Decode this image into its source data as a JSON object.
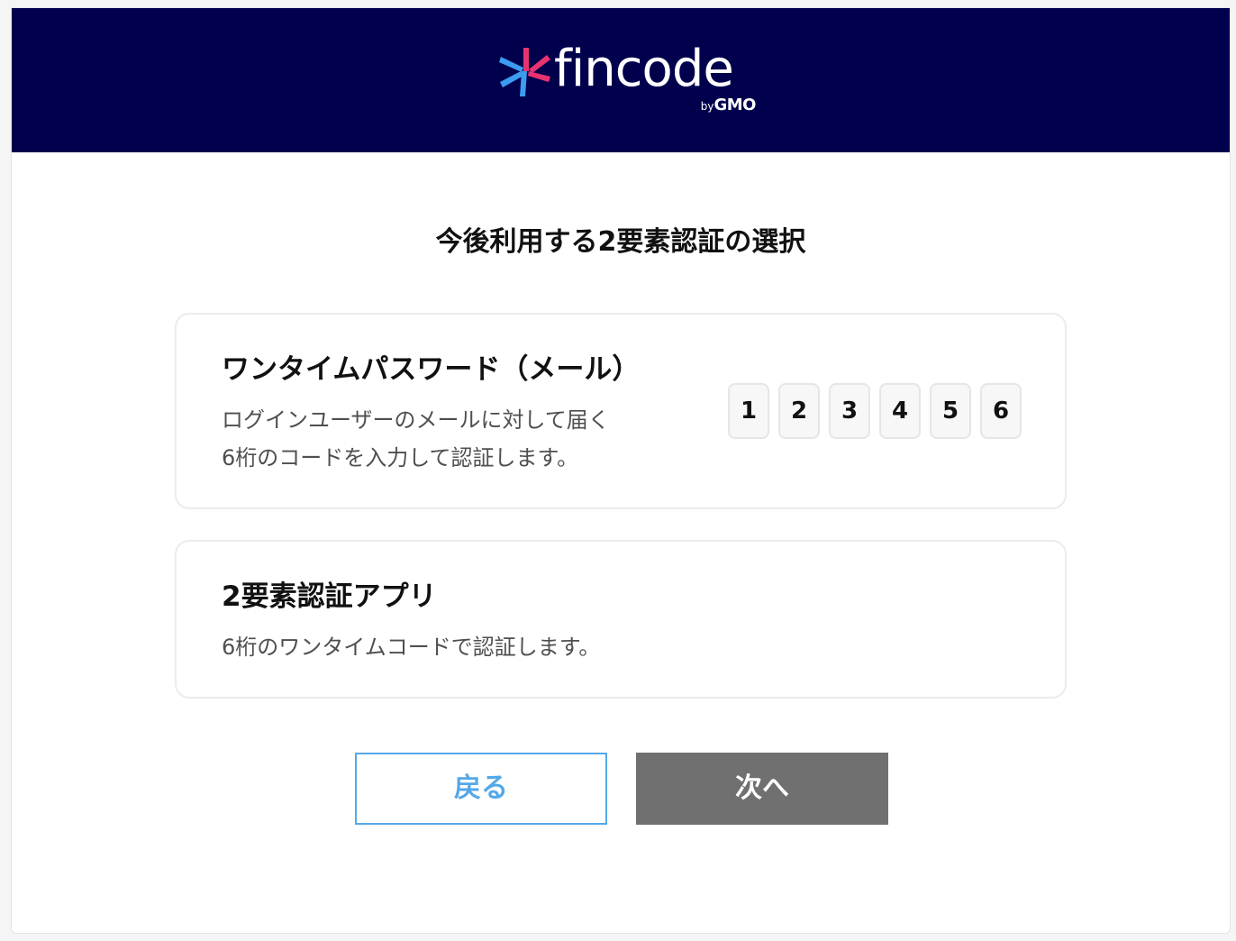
{
  "header": {
    "logo_text": "fincode",
    "logo_by": "by",
    "logo_brand": "GMO"
  },
  "main": {
    "title": "今後利用する2要素認証の選択"
  },
  "options": [
    {
      "title": "ワンタイムパスワード（メール）",
      "description_lines": [
        "ログインユーザーのメールに対して届く",
        "6桁のコードを入力して認証します。"
      ],
      "code_digits": [
        "1",
        "2",
        "3",
        "4",
        "5",
        "6"
      ]
    },
    {
      "title": "2要素認証アプリ",
      "description_lines": [
        "6桁のワンタイムコードで認証します。"
      ]
    }
  ],
  "actions": {
    "back_label": "戻る",
    "next_label": "次へ"
  },
  "colors": {
    "header_bg": "#00004d",
    "accent_blue": "#55a8e8",
    "disabled_gray": "#707070",
    "logo_pink": "#e8336f",
    "logo_blue": "#3b9cf0"
  },
  "icons": {
    "logo_mark": "fincode-asterisk-logo-icon"
  }
}
